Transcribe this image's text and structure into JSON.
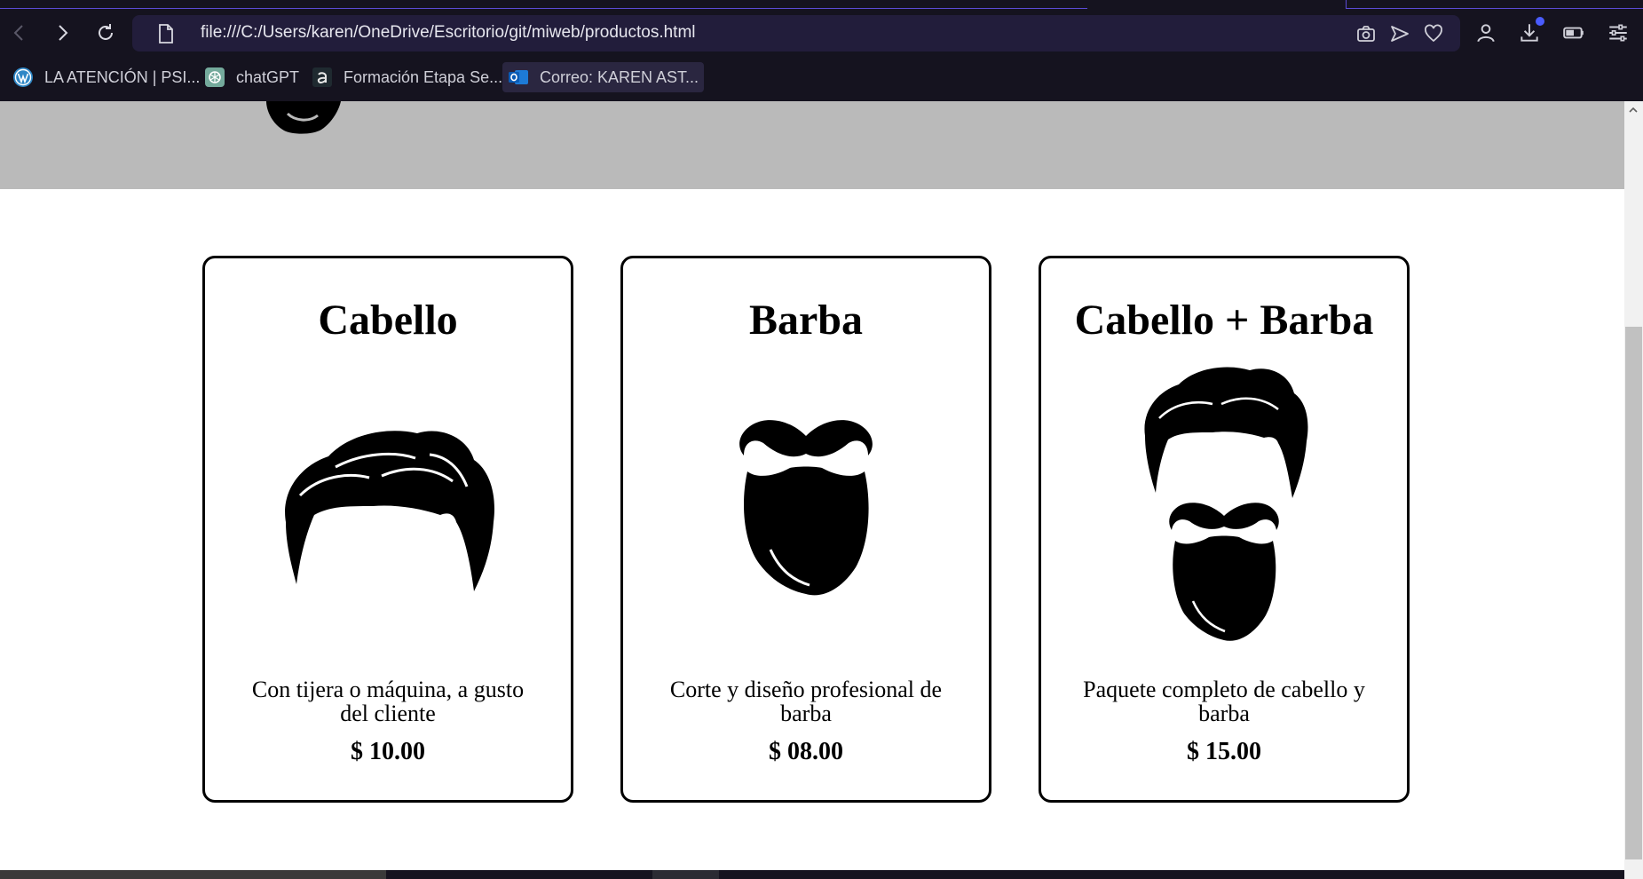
{
  "browser": {
    "url": "file:///C:/Users/karen/OneDrive/Escritorio/git/miweb/productos.html",
    "bookmarks": [
      {
        "label": "LA ATENCIÓN | PSI...",
        "icon": "wordpress-icon"
      },
      {
        "label": "chatGPT",
        "icon": "chatgpt-icon"
      },
      {
        "label": "Formación Etapa Se...",
        "icon": "a-logo-icon"
      },
      {
        "label": "Correo: KAREN AST...",
        "icon": "outlook-icon"
      }
    ],
    "accent": "#4a5cff"
  },
  "products": [
    {
      "title": "Cabello",
      "description": "Con tijera o máquina, a gusto del cliente",
      "price": "$ 10.00",
      "icon": "hair-icon"
    },
    {
      "title": "Barba",
      "description": "Corte y diseño profesional de barba",
      "price": "$ 08.00",
      "icon": "beard-icon"
    },
    {
      "title": "Cabello + Barba",
      "description": "Paquete completo de cabello y barba",
      "price": "$ 15.00",
      "icon": "hair-and-beard-icon"
    }
  ]
}
